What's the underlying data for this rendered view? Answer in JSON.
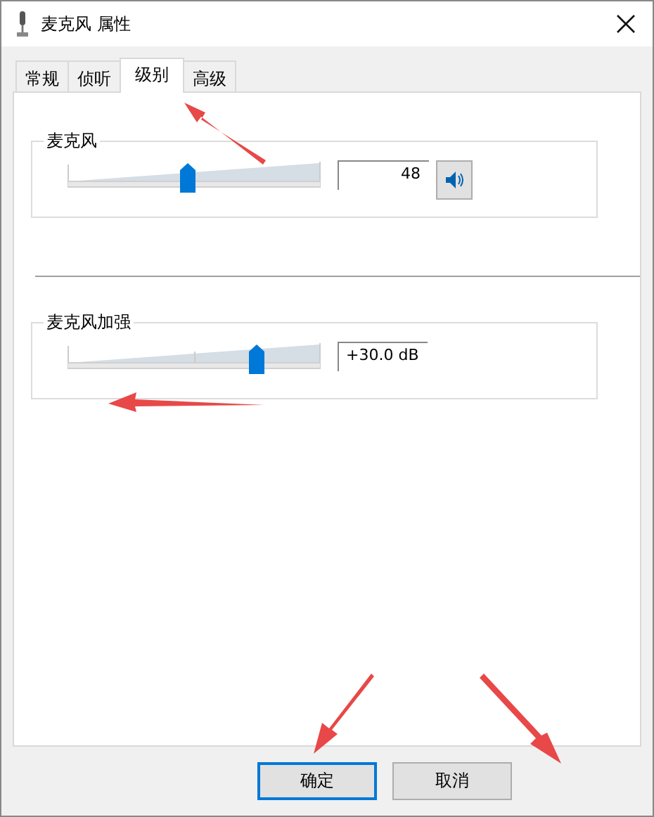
{
  "window": {
    "title": "麦克风 属性"
  },
  "tabs": [
    {
      "label": "常规",
      "selected": false
    },
    {
      "label": "侦听",
      "selected": false
    },
    {
      "label": "级别",
      "selected": true
    },
    {
      "label": "高级",
      "selected": false
    }
  ],
  "groups": [
    {
      "title": "麦克风",
      "level": 0.48,
      "value": "48",
      "ticks": false,
      "mute_button": true,
      "muted": false
    },
    {
      "title": "麦克风加强",
      "level": 0.75,
      "value": "+30.0 dB",
      "ticks": true,
      "mute_button": false
    }
  ],
  "buttons": [
    {
      "label": "确定",
      "default": true
    },
    {
      "label": "取消",
      "default": false
    }
  ]
}
